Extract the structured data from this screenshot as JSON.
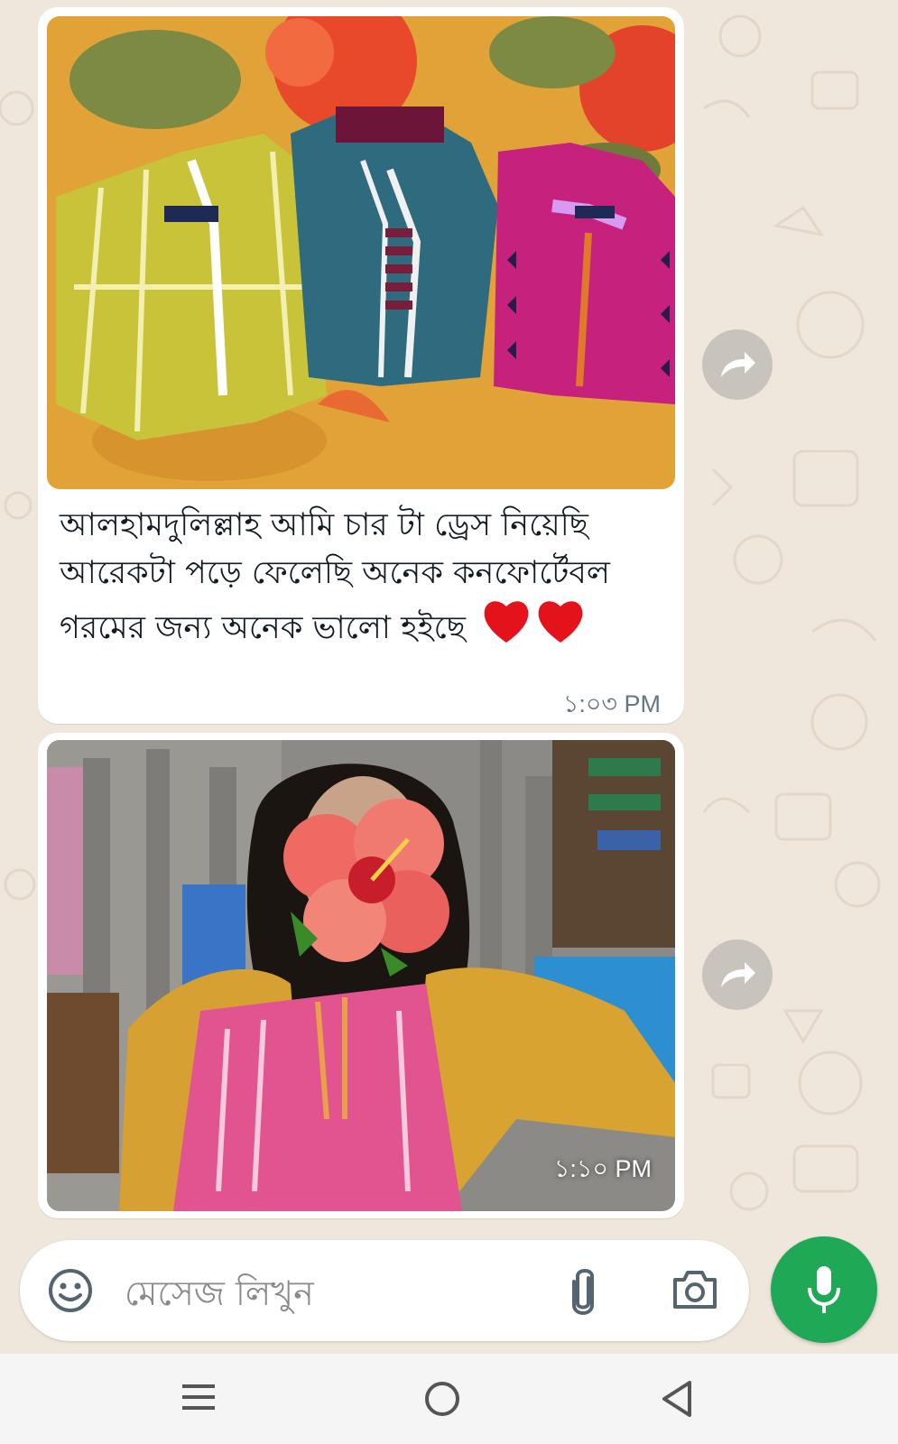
{
  "messages": [
    {
      "image": "photo-of-three-dresses",
      "caption": "আলহামদুলিল্লাহ আমি চার টা ড্রেস নিয়েছি আরেকটা পড়ে ফেলেছি অনেক কনফোর্টেবল গরমের জন্য অনেক ভালো হইছে",
      "emoji": "❤️❤️",
      "time": "১:০৩ PM"
    },
    {
      "image": "photo-of-person-wearing-dress",
      "time": "১:১০ PM"
    }
  ],
  "composer": {
    "placeholder": "মেসেজ লিখুন",
    "icons": [
      "emoji-sticker-icon",
      "attach-icon",
      "camera-icon",
      "mic-icon"
    ]
  },
  "navbar": {
    "icons": [
      "recent-apps-icon",
      "home-icon",
      "back-icon"
    ]
  },
  "colors": {
    "wallpaper": "#efe7dc",
    "bubble": "#ffffff",
    "mic_button": "#1fa855",
    "timestamp": "#667781"
  }
}
